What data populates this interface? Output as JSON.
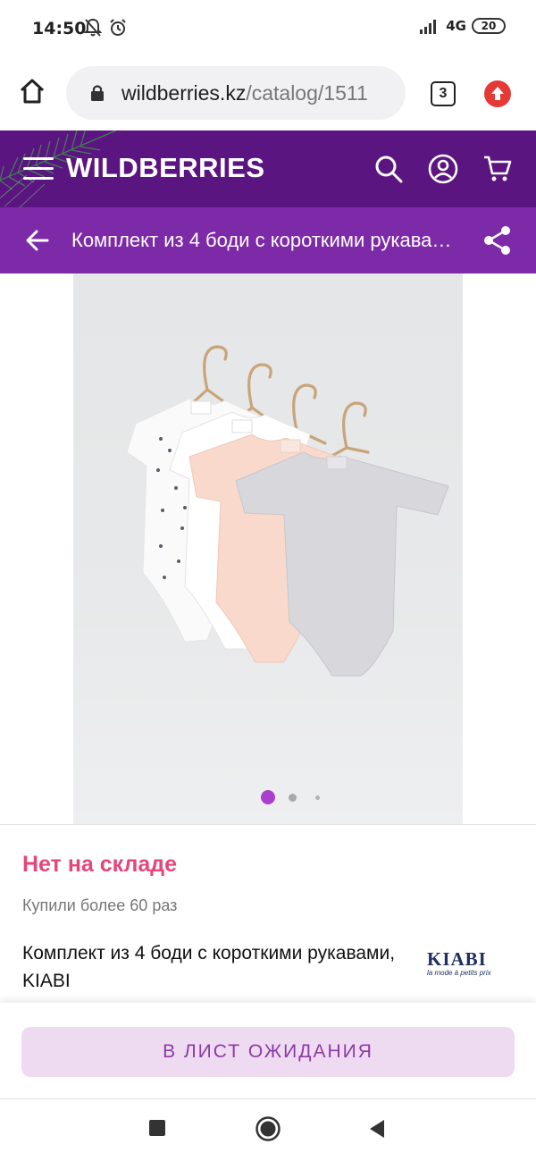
{
  "status_bar": {
    "time": "14:50",
    "network": "4G",
    "battery": "20",
    "icons": [
      "bell-off-icon",
      "alarm-icon",
      "signal-icon",
      "battery-icon"
    ]
  },
  "browser": {
    "url_host": "wildberries.kz",
    "url_path": "/catalog/1511",
    "tab_count": "3",
    "icons": [
      "home-icon",
      "lock-icon",
      "tabs-icon",
      "update-icon"
    ]
  },
  "site_header": {
    "logo": "WILDBERRIES",
    "icons": [
      "menu-icon",
      "search-icon",
      "profile-icon",
      "cart-icon"
    ]
  },
  "title_bar": {
    "title": "Комплект из 4 боди с короткими рукавами, KIABI",
    "icons": [
      "back-arrow-icon",
      "share-icon"
    ]
  },
  "gallery": {
    "slide_count": 3,
    "active_slide": 1
  },
  "product": {
    "stock_status": "Нет на складе",
    "purchases": "Купили более 60 раз",
    "name": "Комплект из 4 боди с короткими рукавами, KIABI",
    "brand_logo": "KIABI",
    "brand_tagline": "la mode à petits prix",
    "stars_display": "★★★★★"
  },
  "actions": {
    "wait_list_label": "В ЛИСТ ОЖИДАНИЯ"
  },
  "android_nav": {
    "icons": [
      "recents-icon",
      "home-circle-icon",
      "back-triangle-icon"
    ]
  },
  "colors": {
    "header_purple": "#5a1581",
    "title_purple": "#7d2aa8",
    "stock_pink": "#e5467a",
    "button_bg": "#eedbf1",
    "button_text": "#8b3aa6",
    "dot_active": "#a93fcf"
  }
}
